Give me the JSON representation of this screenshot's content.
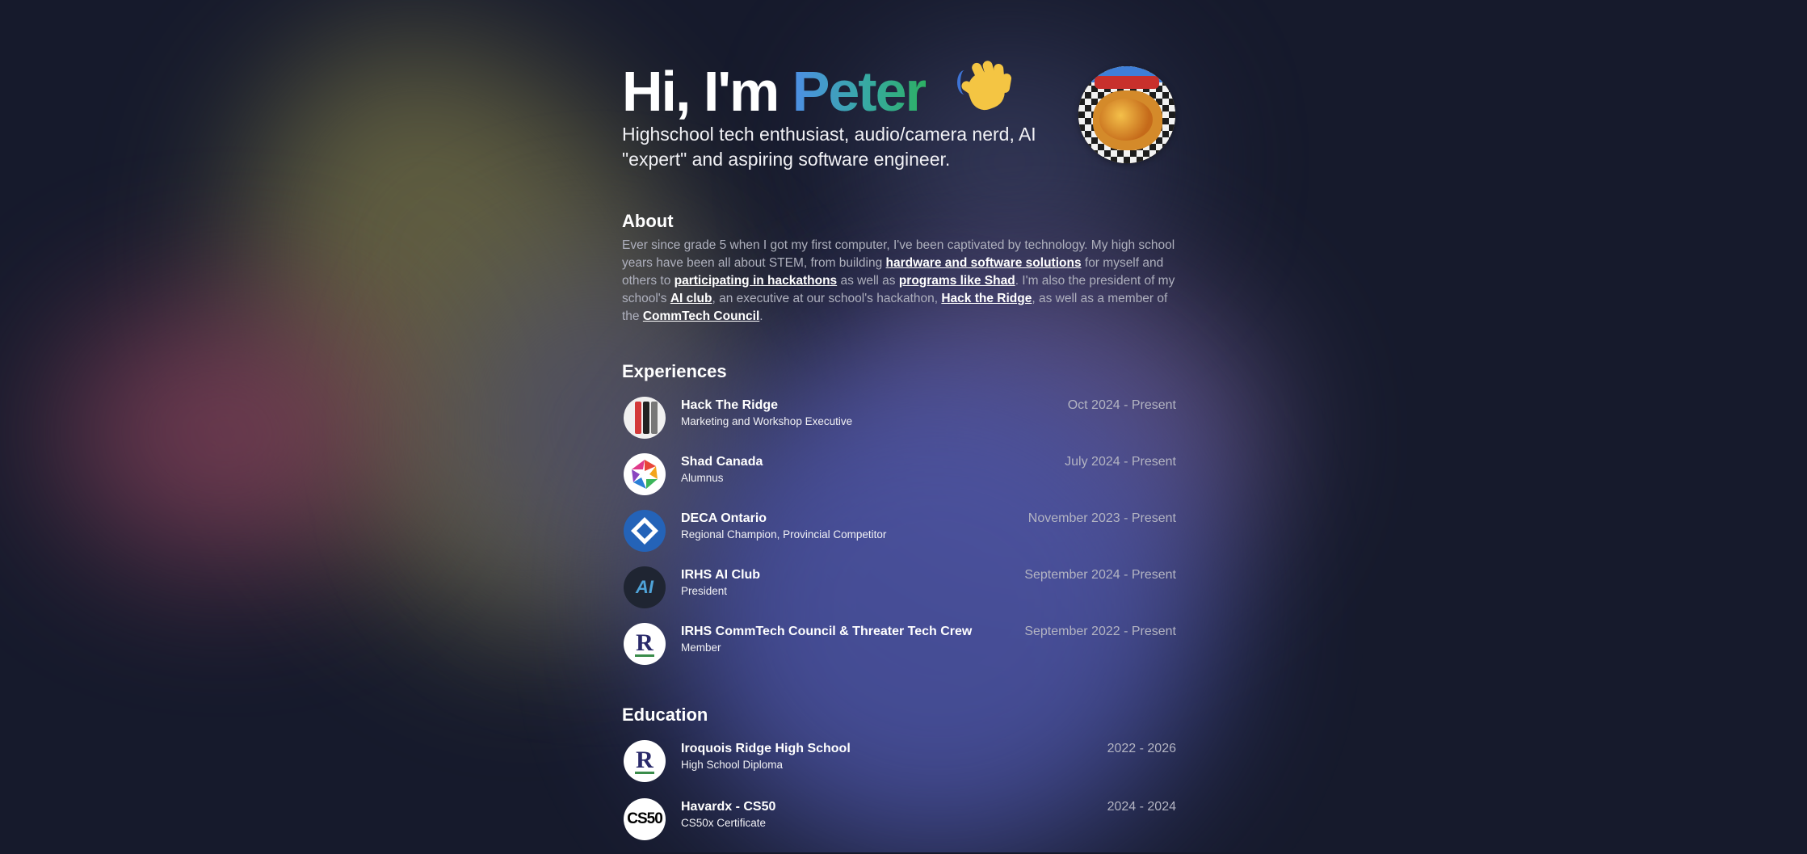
{
  "hero": {
    "greeting": "Hi, I'm",
    "name": "Peter",
    "wave_icon": "waving-hand-icon",
    "subtitle": "Highschool tech enthusiast, audio/camera nerd, AI \"expert\" and aspiring software engineer."
  },
  "about": {
    "title": "About",
    "text_1": "Ever since grade 5 when I got my first computer, I've been captivated by technology. My high school years have been all about STEM, from building ",
    "link_1": "hardware and software solutions",
    "text_2": " for myself and others to ",
    "link_2": "participating in hackathons",
    "text_3": " as well as ",
    "link_3": "programs like Shad",
    "text_4": ". I'm also the president of my school's ",
    "link_4": "AI club",
    "text_5": ", an executive at our school's hackathon, ",
    "link_5": "Hack the Ridge",
    "text_6": ", as well as a member of the ",
    "link_6": "CommTech Council",
    "text_7": "."
  },
  "experiences": {
    "title": "Experiences",
    "items": [
      {
        "name": "Hack The Ridge",
        "role": "Marketing and Workshop Executive",
        "date": "Oct 2024 - Present"
      },
      {
        "name": "Shad Canada",
        "role": "Alumnus",
        "date": "July 2024 - Present"
      },
      {
        "name": "DECA Ontario",
        "role": "Regional Champion, Provincial Competitor",
        "date": "November 2023 - Present"
      },
      {
        "name": "IRHS AI Club",
        "role": "President",
        "date": "September 2024 - Present"
      },
      {
        "name": "IRHS CommTech Council & Threater Tech Crew",
        "role": "Member",
        "date": "September 2022 - Present"
      }
    ]
  },
  "education": {
    "title": "Education",
    "items": [
      {
        "name": "Iroquois Ridge High School",
        "role": "High School Diploma",
        "date": "2022 - 2026"
      },
      {
        "name": "Havardx - CS50",
        "role": "CS50x Certificate",
        "date": "2024 - 2024"
      }
    ]
  },
  "logos": {
    "ai_club": "AI",
    "irhs": "R",
    "cs50": "CS50"
  }
}
